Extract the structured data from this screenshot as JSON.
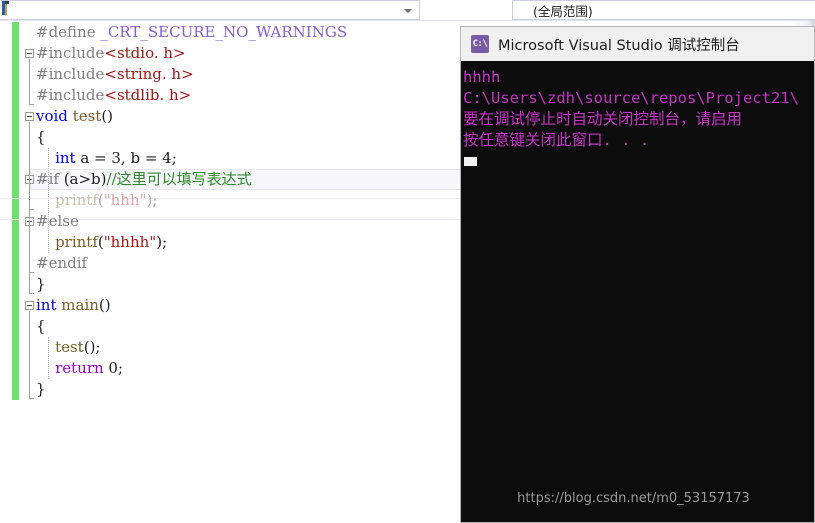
{
  "app": {
    "ide_name": "Microsoft Visual Studio",
    "language": "C"
  },
  "nav_bar": {
    "symbol_combo_value": "",
    "symbol_combo_caret_icon": "chevron-down-icon",
    "scope_combo_value": "(全局范围)"
  },
  "editor": {
    "lines": [
      {
        "indent": 3,
        "tokens": [
          {
            "t": "#define ",
            "c": "t-pp"
          },
          {
            "t": "_CRT_SECURE_NO_WARNINGS",
            "c": "t-macro"
          }
        ]
      },
      {
        "indent": 3,
        "tokens": [
          {
            "t": "#include",
            "c": "t-pp"
          },
          {
            "t": "<stdio. h>",
            "c": "t-inc"
          }
        ]
      },
      {
        "indent": 3,
        "tokens": [
          {
            "t": "#include",
            "c": "t-pp"
          },
          {
            "t": "<string. h>",
            "c": "t-inc"
          }
        ]
      },
      {
        "indent": 3,
        "tokens": [
          {
            "t": "#include",
            "c": "t-pp"
          },
          {
            "t": "<stdlib. h>",
            "c": "t-inc"
          }
        ]
      },
      {
        "indent": 3,
        "tokens": [
          {
            "t": "void",
            "c": "t-kw"
          },
          {
            "t": " ",
            "c": "t-plain"
          },
          {
            "t": "test",
            "c": "t-fn"
          },
          {
            "t": "()",
            "c": "t-plain"
          }
        ]
      },
      {
        "indent": 3,
        "tokens": [
          {
            "t": "{",
            "c": "t-plain"
          }
        ]
      },
      {
        "indent": 3,
        "tokens": [
          {
            "t": "    ",
            "c": "t-plain"
          },
          {
            "t": "int",
            "c": "t-kw"
          },
          {
            "t": " a = 3, b = 4;",
            "c": "t-plain"
          }
        ]
      },
      {
        "indent": 3,
        "tokens": [
          {
            "t": "#if",
            "c": "t-pp"
          },
          {
            "t": " (a>b)",
            "c": "t-plain"
          },
          {
            "t": "//这里可以填写表达式",
            "c": "t-cmt"
          }
        ]
      },
      {
        "indent": 3,
        "tokens": [
          {
            "t": "    ",
            "c": "t-plain"
          },
          {
            "t": "printf",
            "c": "t-fn"
          },
          {
            "t": "(",
            "c": "t-plain"
          },
          {
            "t": "\"hhh\"",
            "c": "t-str"
          },
          {
            "t": ");",
            "c": "t-plain"
          }
        ]
      },
      {
        "indent": 3,
        "tokens": [
          {
            "t": "#else",
            "c": "t-pp"
          }
        ]
      },
      {
        "indent": 3,
        "tokens": [
          {
            "t": "    ",
            "c": "t-plain"
          },
          {
            "t": "printf",
            "c": "t-fn"
          },
          {
            "t": "(",
            "c": "t-plain"
          },
          {
            "t": "\"hhhh\"",
            "c": "t-str"
          },
          {
            "t": ");",
            "c": "t-plain"
          }
        ]
      },
      {
        "indent": 3,
        "tokens": [
          {
            "t": "#endif",
            "c": "t-pp"
          }
        ]
      },
      {
        "indent": 3,
        "tokens": [
          {
            "t": "}",
            "c": "t-plain"
          }
        ]
      },
      {
        "indent": 3,
        "tokens": [
          {
            "t": "int",
            "c": "t-kw"
          },
          {
            "t": " ",
            "c": "t-plain"
          },
          {
            "t": "main",
            "c": "t-fn"
          },
          {
            "t": "()",
            "c": "t-plain"
          }
        ]
      },
      {
        "indent": 3,
        "tokens": [
          {
            "t": "{",
            "c": "t-plain"
          }
        ]
      },
      {
        "indent": 3,
        "tokens": [
          {
            "t": "    ",
            "c": "t-plain"
          },
          {
            "t": "test",
            "c": "t-fn"
          },
          {
            "t": "();",
            "c": "t-plain"
          }
        ]
      },
      {
        "indent": 3,
        "tokens": [
          {
            "t": "    ",
            "c": "t-plain"
          },
          {
            "t": "return",
            "c": "t-ctl"
          },
          {
            "t": " 0;",
            "c": "t-plain"
          }
        ]
      },
      {
        "indent": 3,
        "tokens": [
          {
            "t": "}",
            "c": "t-plain"
          }
        ]
      }
    ],
    "raw_text": [
      "#define _CRT_SECURE_NO_WARNINGS",
      "#include<stdio. h>",
      "#include<string. h>",
      "#include<stdlib. h>",
      "void test()",
      "{",
      "    int a = 3, b = 4;",
      "#if (a>b)//这里可以填写表达式",
      "    printf(\"hhh\");",
      "#else",
      "    printf(\"hhhh\");",
      "#endif",
      "}",
      "int main()",
      "{",
      "    test();",
      "    return 0;",
      "}"
    ],
    "current_line_index": 7,
    "inactive_line_indexes": [
      8
    ],
    "colors": {
      "change_bar_green": "#6ee06e",
      "preprocessor_gray": "#808080",
      "macro_violet": "#8a5cd6",
      "include_red": "#a31515",
      "keyword_blue": "#0000ff",
      "function_brown": "#795e26",
      "string_red": "#a31515",
      "comment_green": "#2e8b2e",
      "control_purple": "#8f08c4",
      "current_line_bg": "#f7f7fb"
    }
  },
  "console": {
    "title": "Microsoft Visual Studio 调试控制台",
    "icon": "console-app-icon",
    "icon_glyph": "C:\\",
    "output_lines": [
      "hhhh",
      "C:\\Users\\zdh\\source\\repos\\Project21\\",
      "要在调试停止时自动关闭控制台，请启用",
      "按任意键关闭此窗口. . ."
    ],
    "text_color": "#c832c8",
    "background_color": "#0c0c0c",
    "cursor_visible": true
  },
  "watermark": {
    "text": "https://blog.csdn.net/m0_53157173"
  }
}
